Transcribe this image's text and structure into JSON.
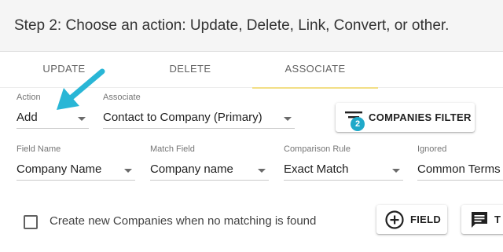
{
  "header": {
    "title": "Step 2: Choose an action: Update, Delete, Link, Convert, or other."
  },
  "tabs": [
    {
      "label": "UPDATE",
      "active": false
    },
    {
      "label": "DELETE",
      "active": false
    },
    {
      "label": "ASSOCIATE",
      "active": true
    }
  ],
  "row1": {
    "action": {
      "label": "Action",
      "value": "Add"
    },
    "associate": {
      "label": "Associate",
      "value": "Contact to Company (Primary)"
    },
    "companies_filter": {
      "label": "COMPANIES FILTER",
      "badge": "2"
    }
  },
  "row2": {
    "field_name": {
      "label": "Field Name",
      "value": "Company Name"
    },
    "match_field": {
      "label": "Match Field",
      "value": "Company name"
    },
    "comparison_rule": {
      "label": "Comparison Rule",
      "value": "Exact Match"
    },
    "ignored": {
      "label": "Ignored",
      "value": "Common Terms"
    }
  },
  "footer": {
    "create_new_label": "Create new Companies when no matching is found",
    "create_new_checked": false,
    "field_button": "FIELD",
    "next_button_partial": "T"
  },
  "colors": {
    "header_bg": "#f5f5f5",
    "tab_indicator": "#f2df86",
    "badge": "#1fa9c9",
    "annotation_arrow": "#29b6d6"
  },
  "icons": {
    "filter": "filter-list-icon",
    "add_field": "add-circle-outline-icon",
    "template": "message-text-icon",
    "annotation": "pointer-arrow-icon"
  }
}
